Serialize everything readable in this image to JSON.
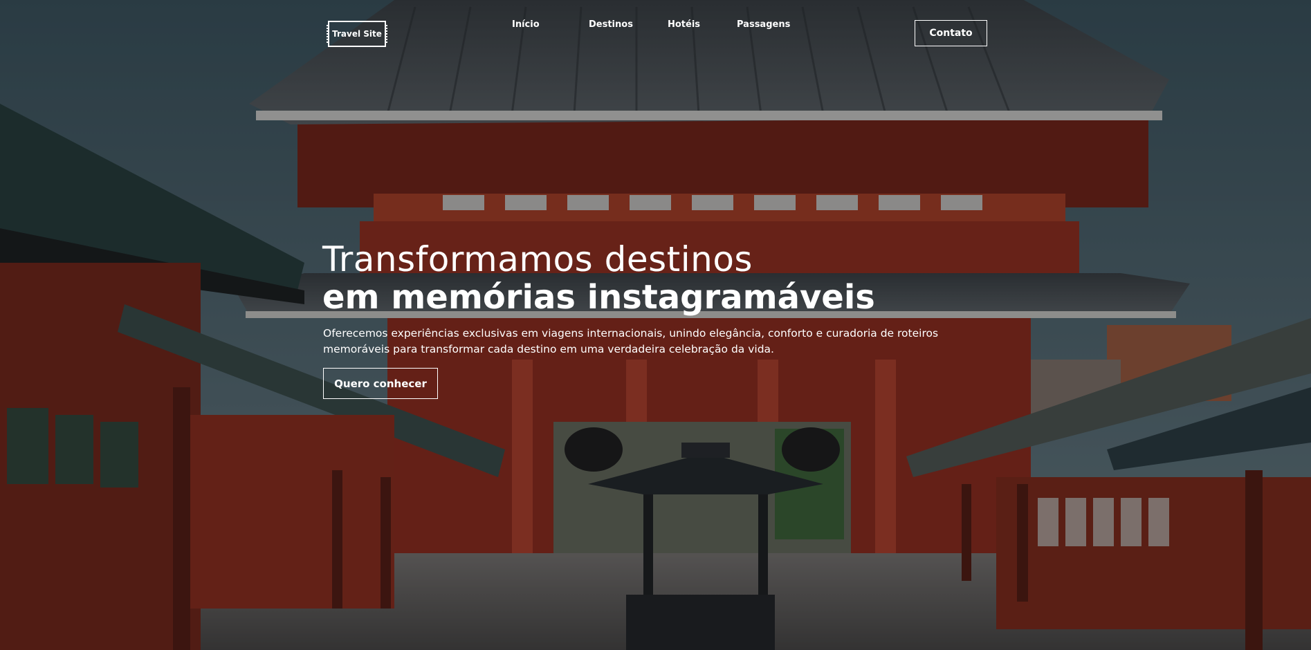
{
  "header": {
    "logo_text": "Travel Site",
    "nav": [
      "Início",
      "Destinos",
      "Hotéis",
      "Passagens"
    ],
    "contact_label": "Contato"
  },
  "hero": {
    "headline_light": "Transformamos destinos",
    "headline_bold": "em memórias instagramáveis",
    "subtitle": "Oferecemos experiências exclusivas em viagens internacionais, unindo elegância, conforto e curadoria de roteiros memoráveis para transformar cada destino em uma verdadeira celebração da vida.",
    "cta_label": "Quero conhecer"
  },
  "colors": {
    "text": "#ffffff",
    "temple_red": "#a8361f",
    "roof_gray": "#4a4f52",
    "sky": "#4f6b74"
  },
  "background_image": "temple-gate-photo"
}
